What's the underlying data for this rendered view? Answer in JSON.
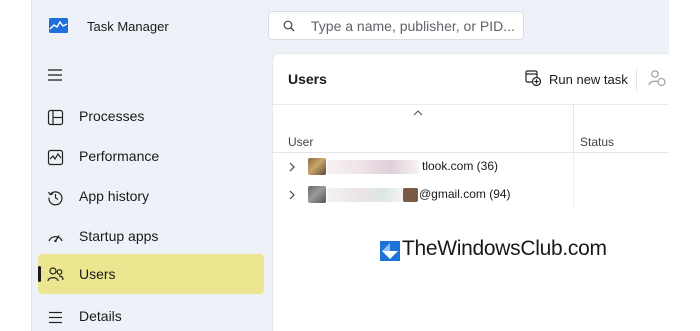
{
  "app": {
    "title": "Task Manager",
    "search_placeholder": "Type a name, publisher, or PID..."
  },
  "nav": {
    "items": [
      {
        "label": "Processes",
        "icon": "processes-icon"
      },
      {
        "label": "Performance",
        "icon": "performance-icon"
      },
      {
        "label": "App history",
        "icon": "app-history-icon"
      },
      {
        "label": "Startup apps",
        "icon": "startup-apps-icon"
      },
      {
        "label": "Users",
        "icon": "users-icon",
        "active": true
      },
      {
        "label": "Details",
        "icon": "details-icon"
      }
    ]
  },
  "content": {
    "title": "Users",
    "run_new_task": "Run new task",
    "columns": {
      "user": "User",
      "status": "Status"
    },
    "rows": [
      {
        "label": "tlook.com (36)"
      },
      {
        "label": "@gmail.com (94)"
      }
    ]
  },
  "watermark": "TheWindowsClub.com",
  "colors": {
    "active_nav_bg": "#ebe68f",
    "window_bg": "#eef2f8",
    "content_bg": "#ffffff"
  }
}
